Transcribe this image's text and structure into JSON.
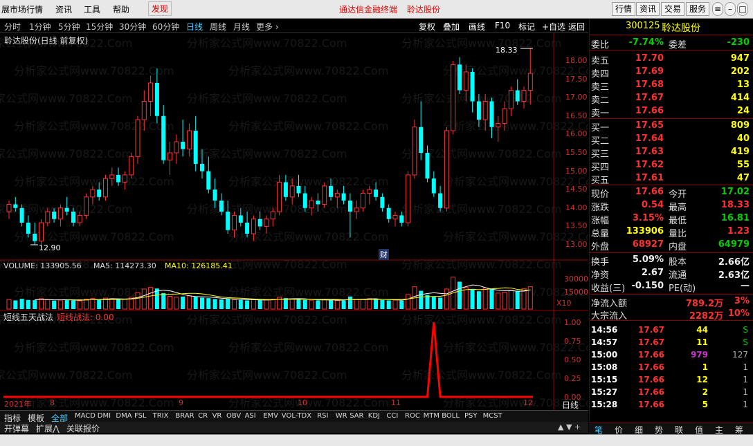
{
  "menu": {
    "items": [
      "展市场行情",
      "资讯",
      "工具",
      "帮助",
      "发现"
    ],
    "center": "通达信金融终端",
    "center_stock": "聆达股份",
    "right_buttons": [
      "行情",
      "资讯",
      "交易",
      "服务"
    ]
  },
  "periods": [
    "分时",
    "1分钟",
    "5分钟",
    "15分钟",
    "30分钟",
    "60分钟",
    "日线",
    "周线",
    "月线",
    "更多 ›"
  ],
  "active_period": "日线",
  "tools": [
    "复权",
    "叠加",
    "画线",
    "F10",
    "标记",
    "+自选",
    "返回"
  ],
  "chart_title": "聆达股份(日线 前复权)",
  "price_axis": [
    "18.00",
    "17.50",
    "17.00",
    "16.50",
    "16.00",
    "15.50",
    "15.00",
    "14.50",
    "14.00",
    "13.50",
    "13.00"
  ],
  "annot_high": "18.33",
  "annot_low": "12.90",
  "cai_label": "财",
  "volume": {
    "label": "VOLUME: 133905.56",
    "ma5": "MA5: 114273.30",
    "ma10": "MA10: 126185.41"
  },
  "vol_axis": [
    "30000",
    "15000",
    "X10"
  ],
  "indicator": {
    "name": "短线五天战法",
    "sub": "短线战法: 0.00"
  },
  "ind_axis": [
    "1.00",
    "0.75",
    "0.50",
    "0.25",
    "0.00"
  ],
  "date_axis": {
    "year": "2021年",
    "months": [
      "8",
      "9",
      "10",
      "11",
      "12"
    ]
  },
  "day_line_label": "日线",
  "ind_tabs": [
    "指标",
    "模板",
    "全部",
    "MACD",
    "DMI",
    "DMA",
    "FSL",
    "TRIX",
    "BRAR",
    "CR",
    "VR",
    "OBV",
    "ASI",
    "EMV",
    "VOL-TDX",
    "RSI",
    "WR",
    "SAR",
    "KDJ",
    "CCI",
    "ROC",
    "MTM",
    "BOLL",
    "PSY",
    "MCST"
  ],
  "bottom_tabs": [
    "开弹幕",
    "扩展⋀",
    "关联报价"
  ],
  "stock": {
    "code": "300125",
    "name": "聆达股份"
  },
  "order_book": {
    "weibi_label": "委比",
    "weibi": "-7.74%",
    "weicha_label": "委差",
    "weicha": "-230",
    "sells": [
      [
        "卖五",
        "17.70",
        "947"
      ],
      [
        "卖四",
        "17.69",
        "202"
      ],
      [
        "卖三",
        "17.68",
        "13"
      ],
      [
        "卖二",
        "17.67",
        "414"
      ],
      [
        "卖一",
        "17.66",
        "24"
      ]
    ],
    "buys": [
      [
        "买一",
        "17.65",
        "809"
      ],
      [
        "买二",
        "17.64",
        "40"
      ],
      [
        "买三",
        "17.63",
        "419"
      ],
      [
        "买四",
        "17.62",
        "55"
      ],
      [
        "买五",
        "17.61",
        "47"
      ]
    ]
  },
  "quote": [
    [
      "现价",
      "17.66",
      "今开",
      "17.02"
    ],
    [
      "涨跌",
      "0.54",
      "最高",
      "18.33"
    ],
    [
      "涨幅",
      "3.15%",
      "最低",
      "16.81"
    ],
    [
      "总量",
      "133906",
      "量比",
      "1.23"
    ],
    [
      "外盘",
      "68927",
      "内盘",
      "64979"
    ]
  ],
  "fund": [
    [
      "换手",
      "5.09%",
      "股本",
      "2.66亿"
    ],
    [
      "净资",
      "2.67",
      "流通",
      "2.63亿"
    ],
    [
      "收益(三)",
      "-0.150",
      "PE(动)",
      "—"
    ]
  ],
  "flow": [
    [
      "净流入额",
      "789.2万",
      "3%"
    ],
    [
      "大宗流入",
      "2282万",
      "10%"
    ]
  ],
  "ticks": [
    [
      "14:56",
      "17.67",
      "44",
      "S"
    ],
    [
      "14:57",
      "17.67",
      "11",
      "S"
    ],
    [
      "15:00",
      "17.66",
      "979",
      "127"
    ],
    [
      "15:08",
      "17.66",
      "1",
      "1"
    ],
    [
      "15:15",
      "17.66",
      "12",
      "1"
    ],
    [
      "15:27",
      "17.66",
      "2",
      "1"
    ],
    [
      "15:28",
      "17.66",
      "5",
      "1"
    ]
  ],
  "right_tabs": [
    "笔",
    "价",
    "细",
    "势",
    "联",
    "值",
    "主",
    "筹"
  ],
  "watermark": "分析家公式网www.70822.Com",
  "chart_data": {
    "type": "candlestick",
    "ylim": [
      12.9,
      18.33
    ],
    "candles": [
      [
        13.9,
        14.2,
        13.7,
        14.1
      ],
      [
        14.1,
        14.3,
        13.9,
        14.0
      ],
      [
        14.0,
        14.1,
        13.5,
        13.6
      ],
      [
        13.6,
        13.8,
        13.2,
        13.3
      ],
      [
        13.3,
        13.6,
        13.0,
        13.1
      ],
      [
        13.1,
        13.7,
        12.9,
        13.6
      ],
      [
        13.6,
        14.0,
        13.5,
        13.9
      ],
      [
        13.9,
        14.0,
        13.6,
        13.7
      ],
      [
        13.7,
        14.1,
        13.5,
        14.0
      ],
      [
        14.0,
        14.3,
        13.8,
        13.9
      ],
      [
        13.9,
        14.0,
        13.5,
        13.6
      ],
      [
        13.6,
        13.9,
        13.5,
        13.8
      ],
      [
        13.8,
        14.4,
        13.7,
        14.3
      ],
      [
        14.3,
        14.6,
        14.1,
        14.5
      ],
      [
        14.5,
        14.7,
        14.2,
        14.3
      ],
      [
        14.3,
        14.9,
        14.2,
        14.8
      ],
      [
        14.8,
        15.1,
        14.6,
        14.9
      ],
      [
        14.9,
        15.1,
        14.6,
        14.7
      ],
      [
        14.7,
        15.0,
        14.5,
        14.9
      ],
      [
        14.9,
        15.5,
        14.8,
        15.4
      ],
      [
        15.4,
        16.5,
        15.2,
        16.4
      ],
      [
        16.4,
        17.2,
        16.1,
        16.9
      ],
      [
        16.9,
        17.6,
        16.5,
        17.4
      ],
      [
        17.4,
        17.8,
        16.3,
        16.5
      ],
      [
        16.5,
        16.8,
        15.2,
        15.3
      ],
      [
        15.3,
        15.8,
        14.9,
        15.5
      ],
      [
        15.5,
        16.0,
        15.2,
        15.8
      ],
      [
        15.8,
        16.4,
        15.4,
        15.6
      ],
      [
        15.6,
        16.3,
        15.4,
        16.1
      ],
      [
        16.1,
        16.5,
        15.0,
        15.2
      ],
      [
        15.2,
        15.6,
        14.8,
        15.0
      ],
      [
        15.0,
        15.4,
        14.4,
        14.5
      ],
      [
        14.5,
        14.8,
        14.0,
        14.2
      ],
      [
        14.2,
        14.4,
        13.8,
        13.9
      ],
      [
        13.9,
        14.2,
        13.3,
        13.4
      ],
      [
        13.4,
        13.9,
        13.2,
        13.8
      ],
      [
        13.8,
        14.0,
        13.5,
        13.6
      ],
      [
        13.6,
        13.9,
        13.2,
        13.3
      ],
      [
        13.3,
        13.8,
        13.1,
        13.7
      ],
      [
        13.7,
        13.9,
        13.4,
        13.5
      ],
      [
        13.5,
        13.8,
        13.3,
        13.7
      ],
      [
        13.7,
        14.0,
        13.5,
        13.9
      ],
      [
        13.9,
        14.9,
        13.8,
        14.7
      ],
      [
        14.7,
        14.9,
        14.2,
        14.3
      ],
      [
        14.3,
        14.8,
        14.1,
        14.6
      ],
      [
        14.6,
        14.9,
        14.3,
        14.4
      ],
      [
        14.4,
        14.6,
        13.9,
        14.0
      ],
      [
        14.0,
        14.3,
        13.8,
        14.2
      ],
      [
        14.2,
        14.4,
        13.9,
        14.1
      ],
      [
        14.1,
        14.7,
        14.0,
        14.6
      ],
      [
        14.6,
        14.8,
        14.2,
        14.3
      ],
      [
        14.3,
        14.5,
        14.0,
        14.4
      ],
      [
        14.4,
        14.6,
        14.1,
        14.2
      ],
      [
        14.2,
        14.4,
        13.2,
        13.9
      ],
      [
        13.9,
        14.2,
        13.7,
        14.0
      ],
      [
        14.0,
        14.5,
        13.9,
        14.4
      ],
      [
        14.4,
        14.6,
        14.1,
        14.5
      ],
      [
        14.5,
        14.7,
        14.2,
        14.3
      ],
      [
        14.3,
        14.4,
        13.9,
        14.0
      ],
      [
        14.0,
        14.1,
        13.6,
        13.7
      ],
      [
        13.7,
        13.9,
        13.5,
        13.8
      ],
      [
        13.8,
        13.9,
        13.5,
        13.6
      ],
      [
        13.6,
        15.0,
        13.5,
        14.9
      ],
      [
        14.9,
        16.4,
        14.8,
        16.2
      ],
      [
        16.2,
        16.9,
        15.3,
        15.5
      ],
      [
        15.5,
        15.7,
        14.7,
        14.8
      ],
      [
        14.8,
        15.0,
        14.3,
        14.4
      ],
      [
        14.4,
        14.6,
        13.9,
        14.0
      ],
      [
        14.0,
        16.2,
        13.9,
        16.1
      ],
      [
        16.1,
        18.0,
        16.0,
        17.9
      ],
      [
        17.9,
        18.1,
        17.1,
        17.2
      ],
      [
        17.2,
        17.9,
        16.9,
        17.7
      ],
      [
        17.7,
        17.8,
        16.6,
        16.9
      ],
      [
        16.9,
        17.1,
        16.2,
        16.4
      ],
      [
        16.4,
        17.1,
        16.1,
        16.9
      ],
      [
        16.9,
        17.0,
        15.9,
        16.2
      ],
      [
        16.2,
        16.5,
        15.8,
        16.3
      ],
      [
        16.3,
        16.9,
        16.1,
        16.7
      ],
      [
        16.7,
        17.3,
        16.5,
        17.2
      ],
      [
        17.2,
        17.5,
        16.8,
        16.9
      ],
      [
        16.9,
        17.3,
        16.7,
        17.2
      ],
      [
        17.2,
        18.33,
        16.81,
        17.66
      ]
    ],
    "volumes": [
      42,
      38,
      45,
      40,
      39,
      46,
      41,
      37,
      40,
      42,
      38,
      36,
      44,
      47,
      43,
      48,
      46,
      41,
      43,
      52,
      72,
      88,
      95,
      90,
      70,
      56,
      52,
      55,
      58,
      54,
      50,
      48,
      44,
      42,
      46,
      41,
      40,
      38,
      42,
      39,
      40,
      43,
      52,
      48,
      44,
      42,
      40,
      39,
      38,
      42,
      40,
      38,
      37,
      55,
      42,
      44,
      46,
      41,
      40,
      38,
      39,
      37,
      64,
      98,
      80,
      62,
      54,
      50,
      88,
      140,
      120,
      95,
      85,
      78,
      92,
      88,
      70,
      74,
      82,
      78,
      90,
      98
    ],
    "signal": {
      "index": 66,
      "value": 1.0
    }
  }
}
